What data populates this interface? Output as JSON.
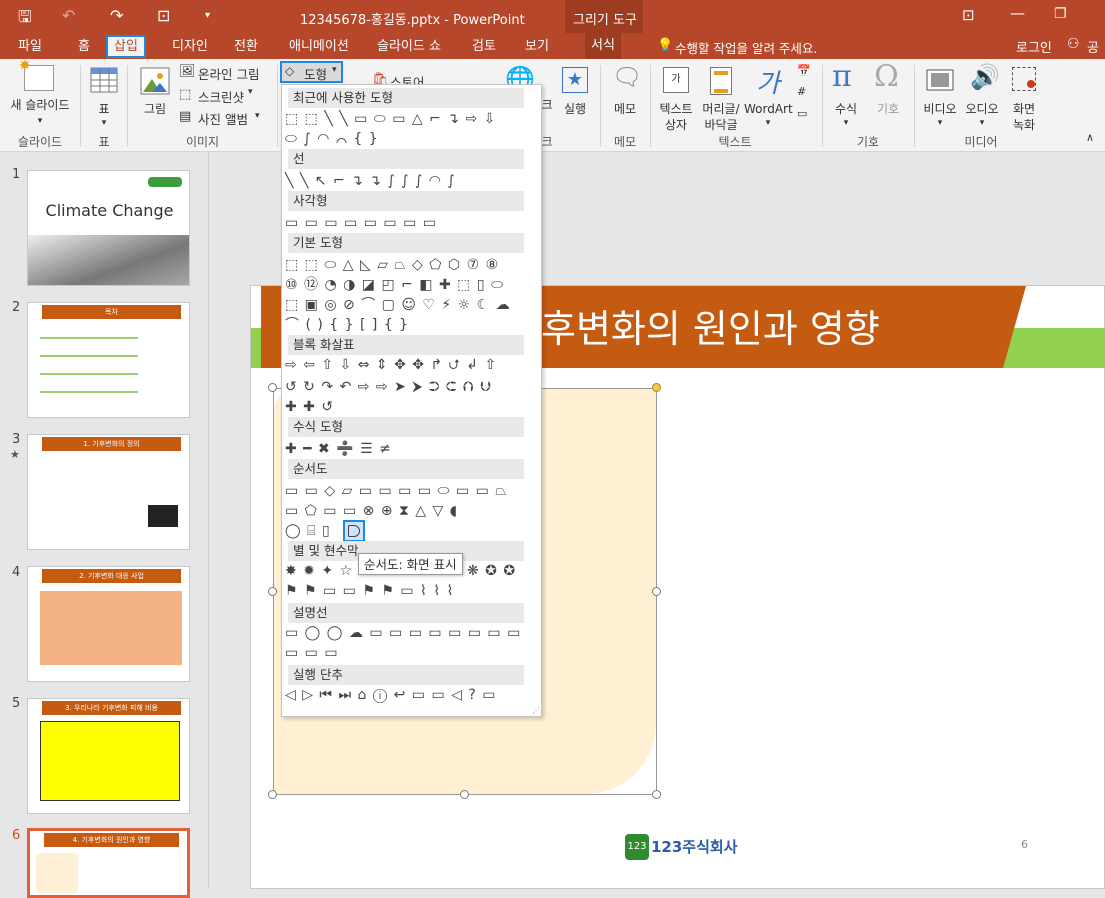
{
  "window": {
    "title": "12345678-홍길동.pptx - PowerPoint",
    "context_tab": "그리기 도구",
    "login": "로그인",
    "share": "공유"
  },
  "menu": {
    "tabs": [
      "파일",
      "홈",
      "삽입",
      "디자인",
      "전환",
      "애니메이션",
      "슬라이드 쇼",
      "검토",
      "보기",
      "서식"
    ],
    "selected": "삽입",
    "tell_me": "수행할 작업을 알려 주세요."
  },
  "ribbon": {
    "new_slide": "새 슬라이드",
    "table": "표",
    "image": "그림",
    "online_image": "온라인 그림",
    "screenshot": "스크린샷",
    "photo_album": "사진 앨범",
    "shapes": "도형",
    "store": "스토어",
    "run": "실행",
    "memo": "메모",
    "textbox_1": "텍스트",
    "textbox_2": "상자",
    "header_1": "머리글/",
    "header_2": "바닥글",
    "wordart": "WordArt",
    "equation": "수식",
    "symbol": "기호",
    "video": "비디오",
    "audio": "오디오",
    "screen_rec_1": "화면",
    "screen_rec_2": "녹화",
    "groups": {
      "slides": "슬라이드",
      "tables": "표",
      "images": "이미지",
      "k": "크",
      "memo": "메모",
      "text": "텍스트",
      "symbols": "기호",
      "media": "미디어"
    }
  },
  "shapes_menu": {
    "sections": [
      "최근에 사용한 도형",
      "선",
      "사각형",
      "기본 도형",
      "블록 화살표",
      "수식 도형",
      "순서도",
      "별 및 현수막",
      "설명선",
      "실행 단추"
    ],
    "rows": {
      "recent_1": "⬚ ⬚ ╲ ╲ ▭ ⬭ ▭ △ ⌐ ↴ ⇨ ⇩",
      "recent_2": "⬭ ∫ ◠ ⌒ { }",
      "lines": "╲ ╲ ↖ ⌐ ↴ ↴ ∫ ∫ ∫ ◠ ∫",
      "rect": "▭ ▭ ▭ ▭ ▭ ▭ ▭ ▭",
      "basic_1": "⬚ ⬚ ⬭ △ ◺ ▱ ⏢ ◇ ⬠ ⬡ ⑦ ⑧",
      "basic_2": "⑩ ⑫ ◔ ◑ ◪ ◰ ⌐ ◧ ✚ ⬚ ▯ ⬭",
      "basic_3": "⬚ ▣ ◎ ⊘ ⌒ ▢ ☺ ♡ ⚡ ☼ ☾ ☁",
      "basic_4": "⌒ ( ) { } [ ] { }",
      "block_1": "⇨ ⇦ ⇧ ⇩ ⇔ ⇕ ✥ ✥ ↱ ⮍ ↲ ⇧",
      "block_2": "↺ ↻ ↷ ↶ ⇨ ⇨ ➤ ⮞ ⮊ ⮈ ⮉ ⮋",
      "block_3": "✚ ✚ ↺",
      "equation": "✚ ━ ✖ ➗ ☰ ≠",
      "flow_1": "▭ ▭ ◇ ▱ ▭ ▭ ▭ ▭ ⬭ ▭ ▭ ⏢",
      "flow_2": "▭ ⬠ ▭ ▭ ⊗ ⊕ ⧗ △ ▽ ◖",
      "flow_3": "◯ ⌸ ▯",
      "stars_1": "✸ ✹ ✦ ☆",
      "stars_2": "❋ ✪ ✪",
      "stars_3": "⚑ ⚑ ▭ ▭ ⚑ ⚑ ▭ ⌇ ⌇ ⌇",
      "callouts_1": "▭ ◯ ◯ ☁ ▭ ▭ ▭ ▭ ▭ ▭ ▭ ▭",
      "callouts_2": "▭ ▭ ▭",
      "action": "◁ ▷ ⏮ ⏭ ⌂ ⓘ ↩ ▭ ▭ ◁ ? ▭"
    },
    "tooltip": "순서도: 화면 표시"
  },
  "thumbs": [
    {
      "num": "1",
      "title": "Climate Change"
    },
    {
      "num": "2",
      "title": "목차"
    },
    {
      "num": "3",
      "title": "1. 기후변화의 정의",
      "star": "★"
    },
    {
      "num": "4",
      "title": "2. 기후변화 대응 사업"
    },
    {
      "num": "5",
      "title": "3. 우리나라 기후변화 피해 비용"
    },
    {
      "num": "6",
      "title": "4. 기후변화의 원인과 영향"
    }
  ],
  "slide": {
    "title": "기후변화의 원인과 영향",
    "visible_title": "후변화의 원인과 영향",
    "logo": "123주식회사",
    "page": "6"
  }
}
